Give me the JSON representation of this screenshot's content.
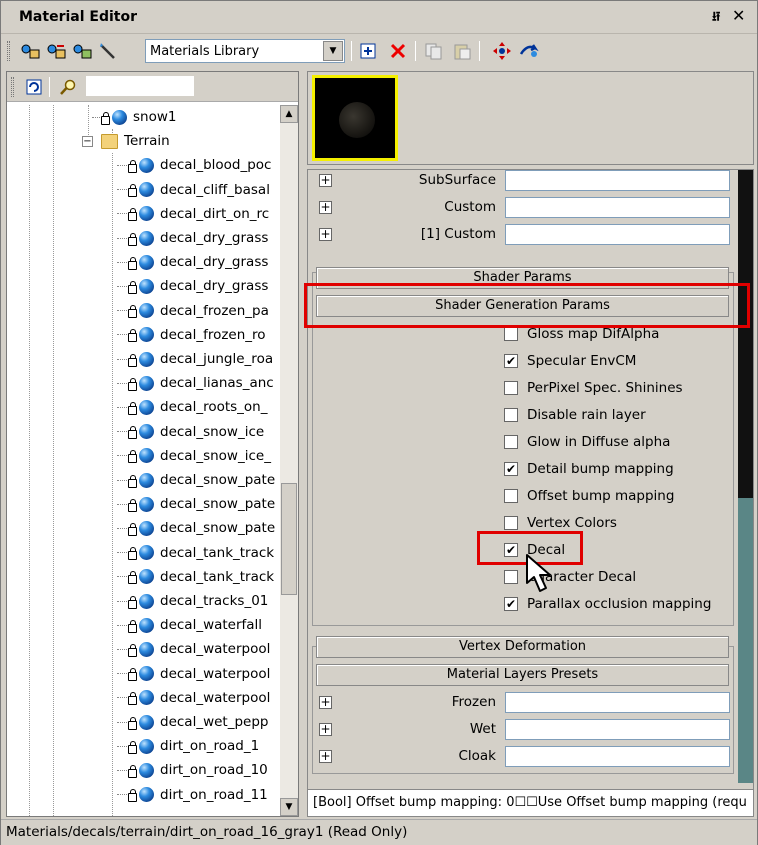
{
  "window": {
    "title": "Material Editor",
    "pin_glyph": "⭿",
    "close_glyph": "✕"
  },
  "toolbar": {
    "library_select_value": "Materials Library",
    "buttons": [
      "get-material-icon",
      "pick-material-icon",
      "assign-material-icon",
      "wand-icon",
      "add-icon",
      "delete-icon",
      "copy-icon",
      "paste-icon",
      "move-icon",
      "reload-icon"
    ]
  },
  "tree": {
    "items": [
      {
        "label": "snow1",
        "type": "material"
      },
      {
        "label": "Terrain",
        "type": "folder"
      },
      {
        "label": "decal_blood_poc",
        "type": "material"
      },
      {
        "label": "decal_cliff_basal",
        "type": "material"
      },
      {
        "label": "decal_dirt_on_rc",
        "type": "material"
      },
      {
        "label": "decal_dry_grass",
        "type": "material"
      },
      {
        "label": "decal_dry_grass",
        "type": "material"
      },
      {
        "label": "decal_dry_grass",
        "type": "material"
      },
      {
        "label": "decal_frozen_pa",
        "type": "material"
      },
      {
        "label": "decal_frozen_ro",
        "type": "material"
      },
      {
        "label": "decal_jungle_roa",
        "type": "material"
      },
      {
        "label": "decal_lianas_anc",
        "type": "material"
      },
      {
        "label": "decal_roots_on_",
        "type": "material"
      },
      {
        "label": "decal_snow_ice",
        "type": "material"
      },
      {
        "label": "decal_snow_ice_",
        "type": "material"
      },
      {
        "label": "decal_snow_pate",
        "type": "material"
      },
      {
        "label": "decal_snow_pate",
        "type": "material"
      },
      {
        "label": "decal_snow_pate",
        "type": "material"
      },
      {
        "label": "decal_tank_track",
        "type": "material"
      },
      {
        "label": "decal_tank_track",
        "type": "material"
      },
      {
        "label": "decal_tracks_01",
        "type": "material"
      },
      {
        "label": "decal_waterfall",
        "type": "material"
      },
      {
        "label": "decal_waterpool",
        "type": "material"
      },
      {
        "label": "decal_waterpool",
        "type": "material"
      },
      {
        "label": "decal_waterpool",
        "type": "material"
      },
      {
        "label": "decal_wet_pepp",
        "type": "material"
      },
      {
        "label": "dirt_on_road_1",
        "type": "material"
      },
      {
        "label": "dirt_on_road_10",
        "type": "material"
      },
      {
        "label": "dirt_on_road_11",
        "type": "material"
      }
    ],
    "expander_glyph": "−"
  },
  "props": {
    "top_rows": [
      {
        "label": "SubSurface",
        "value": ""
      },
      {
        "label": "Custom",
        "value": ""
      },
      {
        "label": "[1] Custom",
        "value": ""
      }
    ],
    "sections": {
      "shader_params": "Shader Params",
      "shader_generation_params": "Shader Generation Params",
      "vertex_deformation": "Vertex Deformation",
      "material_layers_presets": "Material Layers Presets"
    },
    "checks": [
      {
        "label": "Gloss map DifAlpha",
        "checked": false
      },
      {
        "label": "Specular EnvCM",
        "checked": true
      },
      {
        "label": "PerPixel Spec. Shinines",
        "checked": false
      },
      {
        "label": "Disable rain layer",
        "checked": false
      },
      {
        "label": "Glow in Diffuse alpha",
        "checked": false
      },
      {
        "label": "Detail bump mapping",
        "checked": true
      },
      {
        "label": "Offset bump mapping",
        "checked": false
      },
      {
        "label": "Vertex Colors",
        "checked": false
      },
      {
        "label": "Decal",
        "checked": true
      },
      {
        "label": "Character Decal",
        "checked": false
      },
      {
        "label": "Parallax occlusion mapping",
        "checked": true
      }
    ],
    "layer_rows": [
      {
        "label": "Frozen",
        "value": ""
      },
      {
        "label": "Wet",
        "value": ""
      },
      {
        "label": "Cloak",
        "value": ""
      }
    ],
    "plus_glyph": "+",
    "check_glyph": "✔"
  },
  "description": "[Bool] Offset bump mapping: 0☐☐Use Offset bump mapping (requ",
  "status": "Materials/decals/terrain/dirt_on_road_16_gray1 (Read Only)"
}
